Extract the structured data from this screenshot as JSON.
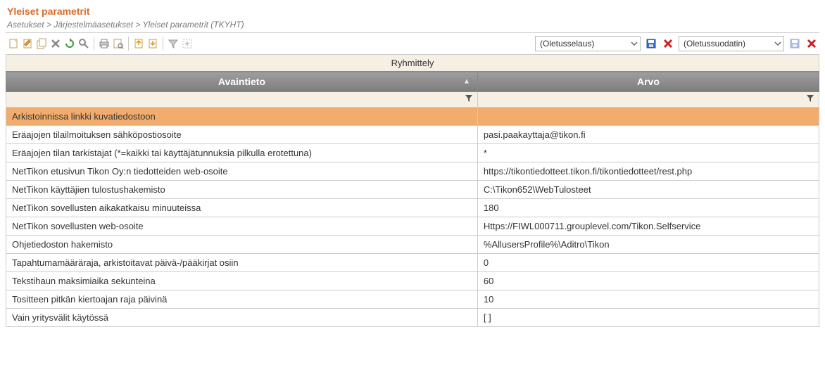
{
  "header": {
    "title": "Yleiset parametrit",
    "breadcrumb": "Asetukset > Järjestelmäasetukset > Yleiset parametrit  (TKYHT)"
  },
  "toolbar": {
    "browse_dropdown": "(Oletusselaus)",
    "filter_dropdown": "(Oletussuodatin)"
  },
  "grid": {
    "group_label": "Ryhmittely",
    "columns": {
      "key": "Avaintieto",
      "value": "Arvo"
    },
    "rows": [
      {
        "key": "Arkistoinnissa linkki kuvatiedostoon",
        "value": "",
        "selected": true
      },
      {
        "key": "Eräajojen tilailmoituksen sähköpostiosoite",
        "value": "pasi.paakayttaja@tikon.fi"
      },
      {
        "key": "Eräajojen tilan tarkistajat  (*=kaikki tai käyttäjätunnuksia pilkulla erotettuna)",
        "value": "*"
      },
      {
        "key": "NetTikon etusivun Tikon Oy:n tiedotteiden web-osoite",
        "value": "https://tikontiedotteet.tikon.fi/tikontiedotteet/rest.php"
      },
      {
        "key": "NetTikon käyttäjien tulostushakemisto",
        "value": "C:\\Tikon652\\WebTulosteet"
      },
      {
        "key": "NetTikon sovellusten aikakatkaisu minuuteissa",
        "value": "180"
      },
      {
        "key": "NetTikon sovellusten web-osoite",
        "value": "Https://FIWL000711.grouplevel.com/Tikon.Selfservice"
      },
      {
        "key": "Ohjetiedoston hakemisto",
        "value": "%AllusersProfile%\\Aditro\\Tikon"
      },
      {
        "key": "Tapahtumamääräraja, arkistoitavat päivä-/pääkirjat osiin",
        "value": "0"
      },
      {
        "key": "Tekstihaun maksimiaika sekunteina",
        "value": "60"
      },
      {
        "key": "Tositteen pitkän kiertoajan raja päivinä",
        "value": "10"
      },
      {
        "key": "Vain yritysvälit käytössä",
        "value": "[ ]"
      }
    ]
  }
}
